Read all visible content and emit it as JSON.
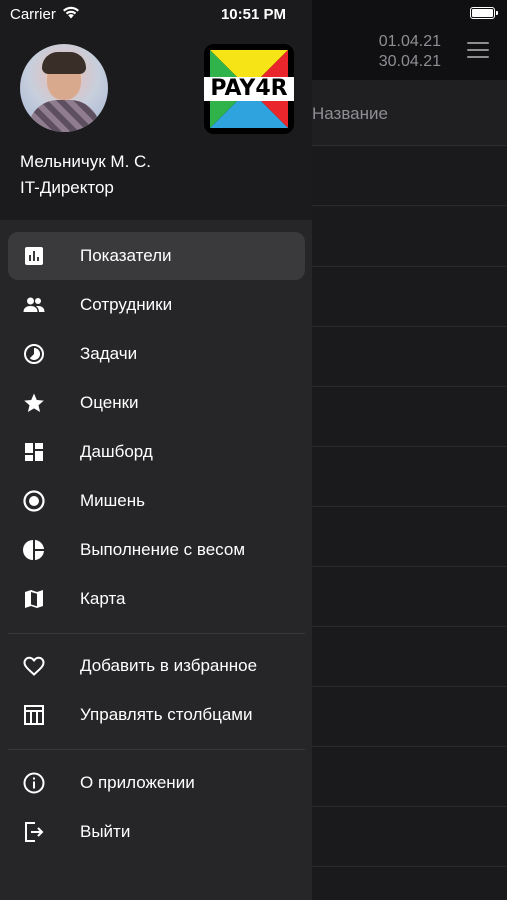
{
  "status_bar": {
    "carrier": "Carrier",
    "time": "10:51 PM"
  },
  "background": {
    "date_from": "01.04.21",
    "date_to": "30.04.21",
    "column_header": "Название"
  },
  "drawer": {
    "user": {
      "name": "Мельничук М. С.",
      "role": "IT-Директор"
    },
    "logo_text": "PAY4R",
    "menu": [
      {
        "label": "Показатели",
        "icon": "bar-chart-icon",
        "active": true
      },
      {
        "label": "Сотрудники",
        "icon": "people-icon"
      },
      {
        "label": "Задачи",
        "icon": "timelapse-icon"
      },
      {
        "label": "Оценки",
        "icon": "star-icon"
      },
      {
        "label": "Дашборд",
        "icon": "dashboard-icon"
      },
      {
        "label": "Мишень",
        "icon": "target-icon"
      },
      {
        "label": "Выполнение с весом",
        "icon": "pie-chart-icon"
      },
      {
        "label": "Карта",
        "icon": "map-icon"
      }
    ],
    "secondary": [
      {
        "label": "Добавить в избранное",
        "icon": "heart-outline-icon"
      },
      {
        "label": "Управлять столбцами",
        "icon": "columns-icon"
      }
    ],
    "footer": [
      {
        "label": "О приложении",
        "icon": "info-icon"
      },
      {
        "label": "Выйти",
        "icon": "logout-icon"
      }
    ]
  },
  "colors": {
    "drawer_bg": "#262628",
    "header_bg": "#1b1b1d",
    "active_item_bg": "#3a3a3d",
    "logo_red": "#e8262b",
    "logo_yellow": "#f7e417",
    "logo_green": "#2fb34a",
    "logo_blue": "#2ea3dd"
  }
}
